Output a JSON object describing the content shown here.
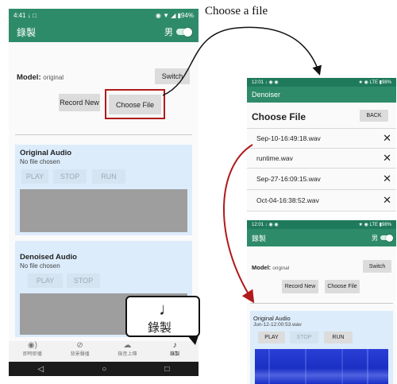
{
  "caption": {
    "text": "Choose a file"
  },
  "left_phone": {
    "status": {
      "time": "4:41",
      "battery": "94%"
    },
    "appbar": {
      "title": "錄製",
      "gender_label": "男"
    },
    "model": {
      "label": "Model:",
      "value": "original",
      "switch_label": "Switch"
    },
    "buttons": {
      "record_new": "Record New",
      "choose_file": "Choose File"
    },
    "original_audio": {
      "title": "Original Audio",
      "status": "No file chosen",
      "play": "PLAY",
      "stop": "STOP",
      "run": "RUN"
    },
    "denoised_audio": {
      "title": "Denoised Audio",
      "status": "No file chosen",
      "play": "PLAY",
      "stop": "STOP"
    },
    "bottom_nav": [
      {
        "label": "即時即播",
        "icon": "mic-wave-icon"
      },
      {
        "label": "背景聲播",
        "icon": "mute-icon"
      },
      {
        "label": "錄音上傳",
        "icon": "cloud-upload-icon"
      },
      {
        "label": "錄製",
        "icon": "music-note-icon"
      }
    ],
    "callout": {
      "label": "錄製"
    }
  },
  "denoiser_phone": {
    "status": {
      "time": "12:01",
      "network": "LTE",
      "battery": "98%"
    },
    "appbar": {
      "title": "Denoiser"
    },
    "header": {
      "title": "Choose File",
      "back_label": "BACK"
    },
    "files": [
      "Sep-10-16:49:18.wav",
      "runtime.wav",
      "Sep-27-16:09:15.wav",
      "Oct-04-16:38:52.wav"
    ]
  },
  "record_phone": {
    "status": {
      "time": "12:01",
      "network": "LTE",
      "battery": "98%"
    },
    "appbar": {
      "title": "錄製",
      "gender_label": "男"
    },
    "model": {
      "label": "Model:",
      "value": "original",
      "switch_label": "Switch"
    },
    "buttons": {
      "record_new": "Record New",
      "choose_file": "Choose File"
    },
    "original_audio": {
      "title": "Original Audio",
      "status": "Jun-12-12:00:53.wav",
      "play": "PLAY",
      "stop": "STOP",
      "run": "RUN"
    }
  },
  "colors": {
    "teal": "#2e8b6a",
    "panel": "#dcecfb",
    "highlight": "#b01a1a",
    "spectrogram": "#1a2ec8"
  }
}
